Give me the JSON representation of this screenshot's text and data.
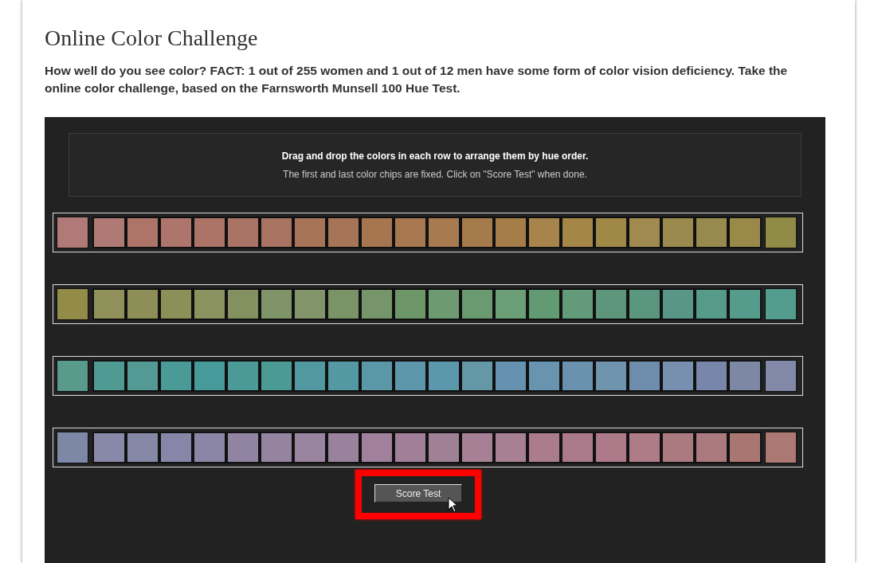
{
  "title": "Online Color Challenge",
  "intro": "How well do you see color? FACT: 1 out of 255 women and 1 out of 12 men have some form of color vision deficiency. Take the online color challenge, based on the Farnsworth Munsell 100 Hue Test.",
  "instructions": {
    "heading": "Drag and drop the colors in each row to arrange them by hue order.",
    "note": "The first and last color chips are fixed. Click on \"Score Test\" when done."
  },
  "rows": [
    {
      "fixed_start": {
        "color": "#b07a78"
      },
      "chips": [
        {
          "color": "#b07a74"
        },
        {
          "color": "#ae7468"
        },
        {
          "color": "#ad756c"
        },
        {
          "color": "#ab7466"
        },
        {
          "color": "#a97366"
        },
        {
          "color": "#a87461"
        },
        {
          "color": "#a7745a"
        },
        {
          "color": "#a67558"
        },
        {
          "color": "#a57650"
        },
        {
          "color": "#a7784f"
        },
        {
          "color": "#a77a50"
        },
        {
          "color": "#a67b4c"
        },
        {
          "color": "#a47d48"
        },
        {
          "color": "#a7844c"
        },
        {
          "color": "#a48647"
        },
        {
          "color": "#a08847"
        },
        {
          "color": "#a08a4f"
        },
        {
          "color": "#9b8a4e"
        },
        {
          "color": "#988a4f"
        },
        {
          "color": "#9a8a4a"
        }
      ],
      "fixed_end": {
        "color": "#908c48"
      }
    },
    {
      "fixed_start": {
        "color": "#928c48"
      },
      "chips": [
        {
          "color": "#90905a"
        },
        {
          "color": "#8e8e58"
        },
        {
          "color": "#8a9058"
        },
        {
          "color": "#8a9360"
        },
        {
          "color": "#82915f"
        },
        {
          "color": "#80946a"
        },
        {
          "color": "#82946a"
        },
        {
          "color": "#7a9468"
        },
        {
          "color": "#76956a"
        },
        {
          "color": "#6c9668"
        },
        {
          "color": "#6e9a72"
        },
        {
          "color": "#6a9a70"
        },
        {
          "color": "#6c9e78"
        },
        {
          "color": "#629a74"
        },
        {
          "color": "#629a7a"
        },
        {
          "color": "#5e967c"
        },
        {
          "color": "#5a9680"
        },
        {
          "color": "#589686"
        },
        {
          "color": "#569a8a"
        },
        {
          "color": "#559c8c"
        }
      ],
      "fixed_end": {
        "color": "#549c8e"
      }
    },
    {
      "fixed_start": {
        "color": "#589a8c"
      },
      "chips": [
        {
          "color": "#509a94"
        },
        {
          "color": "#549a94"
        },
        {
          "color": "#4a9a98"
        },
        {
          "color": "#469a9a"
        },
        {
          "color": "#4c9a98"
        },
        {
          "color": "#4c9a96"
        },
        {
          "color": "#5298a0"
        },
        {
          "color": "#5498a4"
        },
        {
          "color": "#5a98a8"
        },
        {
          "color": "#5c96aa"
        },
        {
          "color": "#5c98ac"
        },
        {
          "color": "#6498a6"
        },
        {
          "color": "#6492b0"
        },
        {
          "color": "#6894b0"
        },
        {
          "color": "#6a92ae"
        },
        {
          "color": "#6e94ae"
        },
        {
          "color": "#6e8cac"
        },
        {
          "color": "#7890b0"
        },
        {
          "color": "#7886ac"
        },
        {
          "color": "#7c88a4"
        }
      ],
      "fixed_end": {
        "color": "#8288a8"
      }
    },
    {
      "fixed_start": {
        "color": "#7c88a6"
      },
      "chips": [
        {
          "color": "#8888a8"
        },
        {
          "color": "#8488a6"
        },
        {
          "color": "#8886a8"
        },
        {
          "color": "#8c86a6"
        },
        {
          "color": "#9084a2"
        },
        {
          "color": "#9484a0"
        },
        {
          "color": "#98849e"
        },
        {
          "color": "#98829c"
        },
        {
          "color": "#a0809a"
        },
        {
          "color": "#a27f98"
        },
        {
          "color": "#a08094"
        },
        {
          "color": "#a88096"
        },
        {
          "color": "#a88094"
        },
        {
          "color": "#aa7c8c"
        },
        {
          "color": "#aa7a8a"
        },
        {
          "color": "#ac7a88"
        },
        {
          "color": "#ae7c86"
        },
        {
          "color": "#aa7a80"
        },
        {
          "color": "#aa7a7e"
        },
        {
          "color": "#aa7672"
        }
      ],
      "fixed_end": {
        "color": "#ac7874"
      }
    }
  ],
  "score_button": {
    "label": "Score Test"
  }
}
